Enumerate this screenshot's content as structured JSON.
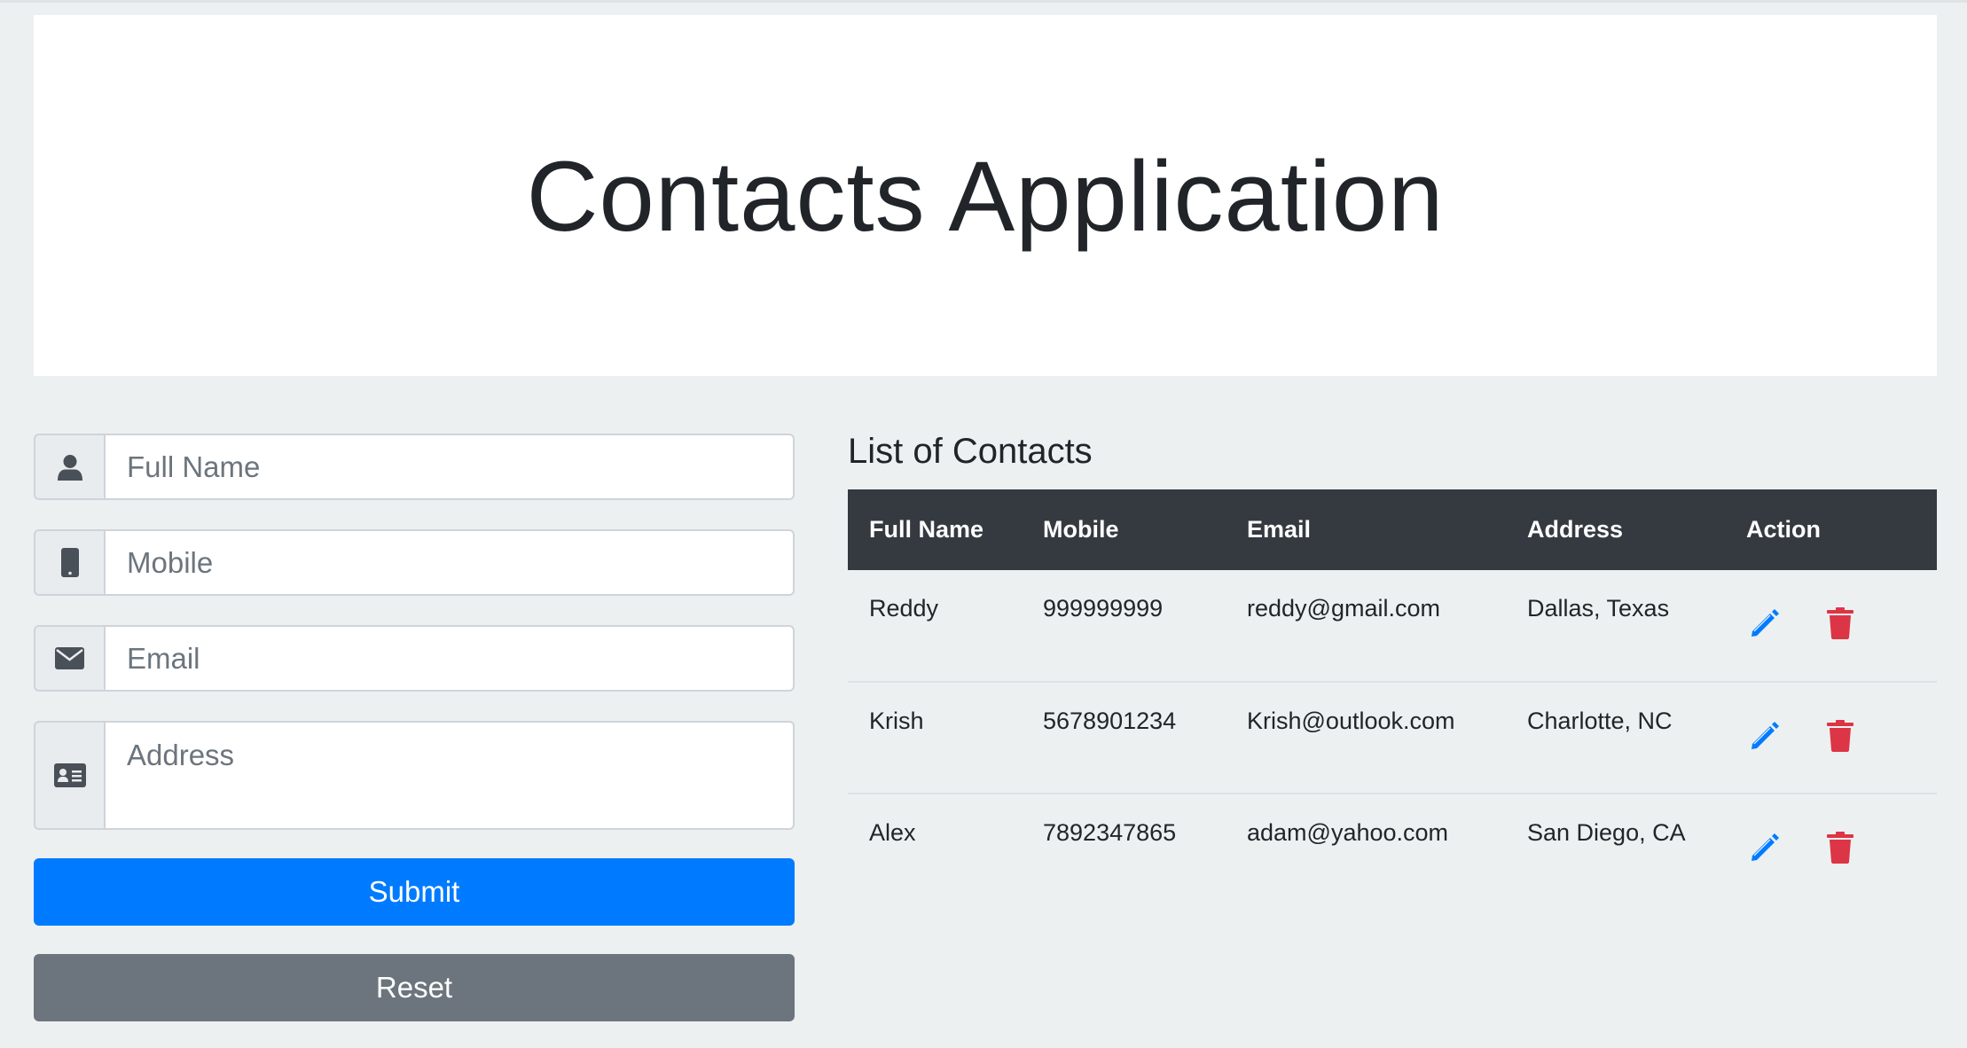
{
  "header": {
    "title": "Contacts Application"
  },
  "form": {
    "full_name": {
      "placeholder": "Full Name",
      "value": "",
      "icon": "user-icon"
    },
    "mobile": {
      "placeholder": "Mobile",
      "value": "",
      "icon": "mobile-phone-icon"
    },
    "email": {
      "placeholder": "Email",
      "value": "",
      "icon": "envelope-icon"
    },
    "address": {
      "placeholder": "Address",
      "value": "",
      "icon": "address-card-icon"
    },
    "submit_label": "Submit",
    "reset_label": "Reset"
  },
  "contacts": {
    "title": "List of Contacts",
    "columns": [
      "Full Name",
      "Mobile",
      "Email",
      "Address",
      "Action"
    ],
    "rows": [
      {
        "name": "Reddy",
        "mobile": "999999999",
        "email": "reddy@gmail.com",
        "address": "Dallas, Texas"
      },
      {
        "name": "Krish",
        "mobile": "5678901234",
        "email": "Krish@outlook.com",
        "address": "Charlotte, NC"
      },
      {
        "name": "Alex",
        "mobile": "7892347865",
        "email": "adam@yahoo.com",
        "address": "San Diego, CA"
      }
    ],
    "edit_icon": "pencil-icon",
    "delete_icon": "trash-icon"
  },
  "colors": {
    "primary": "#007bff",
    "secondary": "#6c757d",
    "table_header": "#343a40",
    "delete": "#dc3545",
    "background": "#edf0f1"
  }
}
